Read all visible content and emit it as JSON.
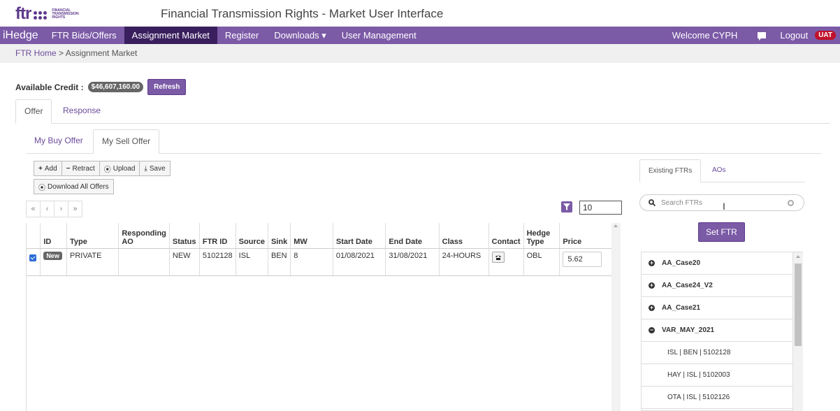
{
  "header": {
    "logo_text": "ftr",
    "logo_subtext": "FINANCIAL TRANSMISSION RIGHTS",
    "app_title": "Financial Transmission Rights - Market User Interface"
  },
  "navbar": {
    "brand": "iHedge",
    "items": [
      {
        "label": "FTR Bids/Offers"
      },
      {
        "label": "Assignment Market"
      },
      {
        "label": "Register"
      },
      {
        "label": "Downloads ▾"
      },
      {
        "label": "User Management"
      }
    ],
    "welcome": "Welcome CYPH",
    "logout": "Logout",
    "env_badge": "UAT"
  },
  "breadcrumb": {
    "home": "FTR Home",
    "separator": " > ",
    "current": "Assignment Market"
  },
  "credit": {
    "label": "Available Credit :",
    "value": "$46,607,160.00",
    "refresh": "Refresh"
  },
  "tabs_main": [
    {
      "label": "Offer"
    },
    {
      "label": "Response"
    }
  ],
  "tabs_offer": [
    {
      "label": "My Buy Offer"
    },
    {
      "label": "My Sell Offer"
    }
  ],
  "toolbar": {
    "add": "Add",
    "retract": "Retract",
    "upload": "Upload",
    "save": "Save",
    "download_all": "Download All Offers"
  },
  "pager": {
    "first": "«",
    "prev": "‹",
    "next": "›",
    "last": "»"
  },
  "page_size": "10",
  "table": {
    "headers": [
      "",
      "ID",
      "Type",
      "Responding AO",
      "Status",
      "FTR ID",
      "Source",
      "Sink",
      "MW",
      "Start Date",
      "End Date",
      "Class",
      "Contact",
      "Hedge Type",
      "Price"
    ],
    "rows": [
      {
        "id_badge": "New",
        "type": "PRIVATE",
        "responding_ao": "",
        "status": "NEW",
        "ftr_id": "5102128",
        "source": "ISL",
        "sink": "BEN",
        "mw": "8",
        "start_date": "01/08/2021",
        "end_date": "31/08/2021",
        "class": "24-HOURS",
        "hedge_type": "OBL",
        "price": "5.62"
      }
    ]
  },
  "right_panel": {
    "tabs": [
      {
        "label": "Existing FTRs"
      },
      {
        "label": "AOs"
      }
    ],
    "search_placeholder": "Search FTRs",
    "set_ftr": "Set FTR",
    "groups": [
      {
        "name": "AA_Case20",
        "expanded": false
      },
      {
        "name": "AA_Case24_V2",
        "expanded": false
      },
      {
        "name": "AA_Case21",
        "expanded": false
      },
      {
        "name": "VAR_MAY_2021",
        "expanded": true
      }
    ],
    "sub_items": [
      "ISL | BEN | 5102128",
      "HAY | ISL | 5102003",
      "OTA | ISL | 5102126"
    ]
  },
  "colors": {
    "brand_purple": "#7b5aa6",
    "nav_active": "#3a1f5e",
    "uat_red": "#c0102a"
  }
}
